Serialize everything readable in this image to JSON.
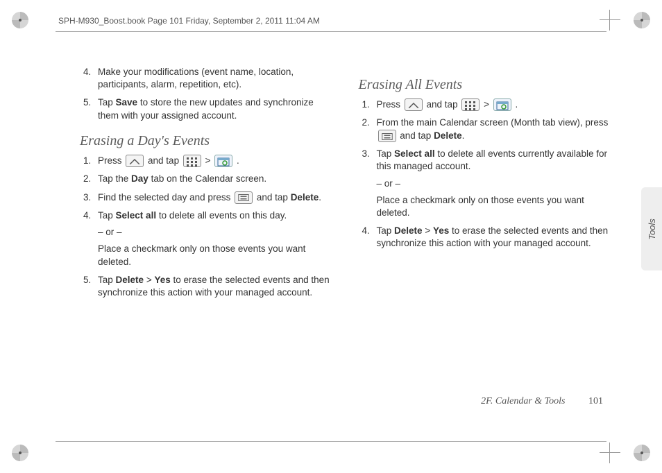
{
  "header": "SPH-M930_Boost.book  Page 101  Friday, September 2, 2011  11:04 AM",
  "side_tab": "Tools",
  "footer": {
    "section": "2F. Calendar & Tools",
    "page": "101"
  },
  "col1": {
    "cont": {
      "s4": "Make your modifications (event name, location, participants, alarm, repetition, etc).",
      "s5a": "Tap ",
      "s5b": "Save",
      "s5c": " to store the new updates and synchronize them with your assigned account."
    },
    "h1": "Erasing a Day's Events",
    "l1": {
      "s1a": "Press ",
      "s1b": " and tap ",
      "s1c": " > ",
      "s1d": ".",
      "s2a": "Tap the ",
      "s2b": "Day",
      "s2c": " tab on the Calendar screen.",
      "s3a": "Find the selected day and press ",
      "s3b": " and tap ",
      "s3c": "Delete",
      "s3d": ".",
      "s4a": "Tap ",
      "s4b": "Select all",
      "s4c": " to delete all events on this day.",
      "s4or": "– or –",
      "s4d": "Place a checkmark only on those events you want deleted.",
      "s5a": "Tap ",
      "s5b": "Delete",
      "s5c": " > ",
      "s5d": "Yes",
      "s5e": " to erase the selected events and then synchronize this action with your managed account."
    }
  },
  "col2": {
    "h1": "Erasing All Events",
    "l1": {
      "s1a": "Press ",
      "s1b": " and tap ",
      "s1c": " > ",
      "s1d": ".",
      "s2a": "From the main Calendar screen (Month tab view), press ",
      "s2b": " and tap ",
      "s2c": "Delete",
      "s2d": ".",
      "s3a": "Tap ",
      "s3b": "Select all",
      "s3c": " to delete all events currently available for this managed account.",
      "s3or": "– or –",
      "s3d": "Place a checkmark only on those events you want deleted.",
      "s4a": "Tap ",
      "s4b": "Delete",
      "s4c": " > ",
      "s4d": "Yes",
      "s4e": " to erase the selected events and then synchronize this action with your managed account."
    }
  }
}
